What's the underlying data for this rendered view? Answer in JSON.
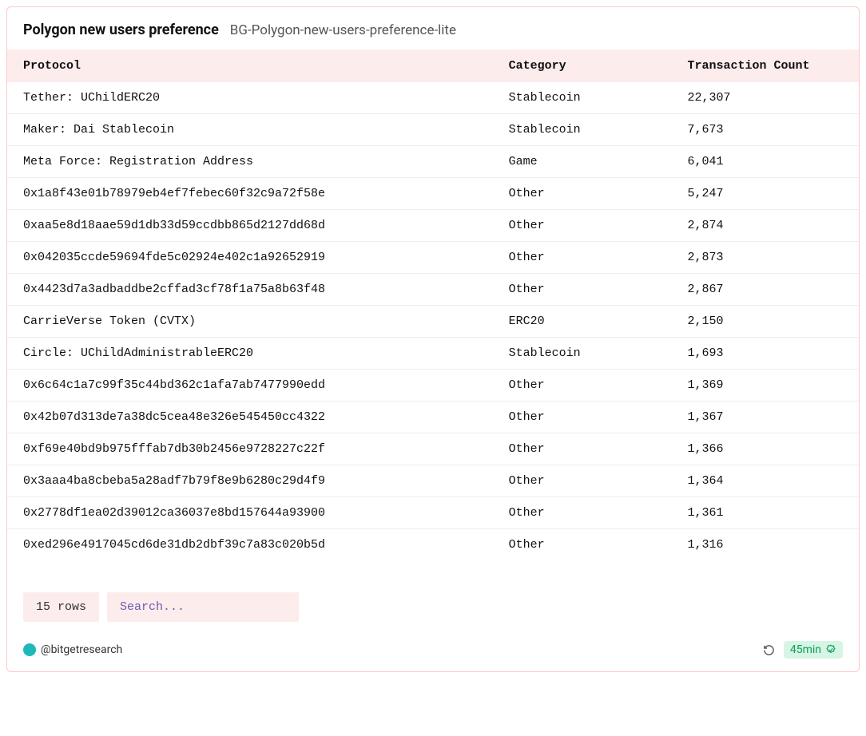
{
  "header": {
    "title": "Polygon new users preference",
    "subtitle": "BG-Polygon-new-users-preference-lite"
  },
  "table": {
    "columns": [
      "Protocol",
      "Category",
      "Transaction Count"
    ],
    "rows": [
      {
        "protocol": "Tether: UChildERC20",
        "category": "Stablecoin",
        "count": "22,307"
      },
      {
        "protocol": "Maker: Dai Stablecoin",
        "category": "Stablecoin",
        "count": "7,673"
      },
      {
        "protocol": "Meta Force: Registration Address",
        "category": "Game",
        "count": "6,041"
      },
      {
        "protocol": "0x1a8f43e01b78979eb4ef7febec60f32c9a72f58e",
        "category": "Other",
        "count": "5,247"
      },
      {
        "protocol": "0xaa5e8d18aae59d1db33d59ccdbb865d2127dd68d",
        "category": "Other",
        "count": "2,874"
      },
      {
        "protocol": "0x042035ccde59694fde5c02924e402c1a92652919",
        "category": "Other",
        "count": "2,873"
      },
      {
        "protocol": "0x4423d7a3adbaddbe2cffad3cf78f1a75a8b63f48",
        "category": "Other",
        "count": "2,867"
      },
      {
        "protocol": "CarrieVerse Token (CVTX)",
        "category": "ERC20",
        "count": "2,150"
      },
      {
        "protocol": "Circle: UChildAdministrableERC20",
        "category": "Stablecoin",
        "count": "1,693"
      },
      {
        "protocol": "0x6c64c1a7c99f35c44bd362c1afa7ab7477990edd",
        "category": "Other",
        "count": "1,369"
      },
      {
        "protocol": "0x42b07d313de7a38dc5cea48e326e545450cc4322",
        "category": "Other",
        "count": "1,367"
      },
      {
        "protocol": "0xf69e40bd9b975fffab7db30b2456e9728227c22f",
        "category": "Other",
        "count": "1,366"
      },
      {
        "protocol": "0x3aaa4ba8cbeba5a28adf7b79f8e9b6280c29d4f9",
        "category": "Other",
        "count": "1,364"
      },
      {
        "protocol": "0x2778df1ea02d39012ca36037e8bd157644a93900",
        "category": "Other",
        "count": "1,361"
      },
      {
        "protocol": "0xed296e4917045cd6de31db2dbf39c7a83c020b5d",
        "category": "Other",
        "count": "1,316"
      }
    ]
  },
  "footer": {
    "rows_label": "15 rows",
    "search_placeholder": "Search...",
    "author_handle": "@bitgetresearch",
    "time_label": "45min"
  }
}
